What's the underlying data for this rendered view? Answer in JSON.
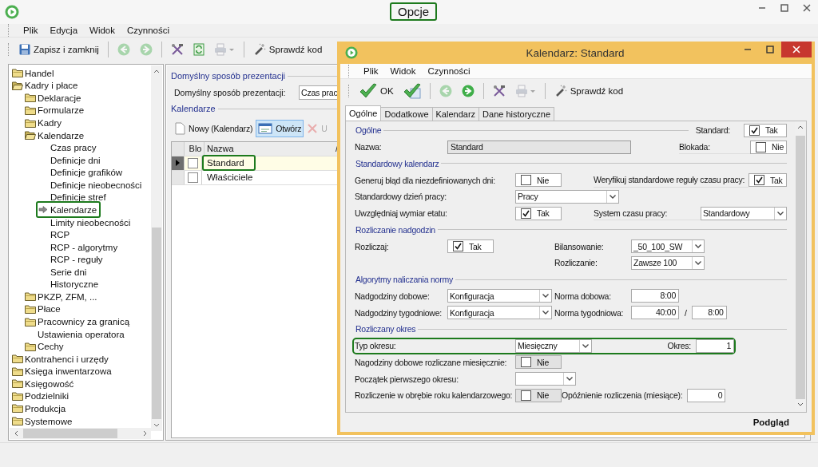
{
  "window": {
    "title": "Opcje",
    "highlighted": true
  },
  "menu": [
    "Plik",
    "Edycja",
    "Widok",
    "Czynności"
  ],
  "toolbar": [
    {
      "kind": "save",
      "label": "Zapisz i zamknij",
      "disabled": false
    },
    {
      "kind": "separator"
    },
    {
      "kind": "back",
      "disabled": true
    },
    {
      "kind": "forward",
      "disabled": true
    },
    {
      "kind": "separator"
    },
    {
      "kind": "tools",
      "disabled": false
    },
    {
      "kind": "refresh",
      "disabled": false
    },
    {
      "kind": "print",
      "disabled": true
    },
    {
      "kind": "separator"
    },
    {
      "kind": "wand",
      "label": "Sprawdź kod",
      "disabled": false
    }
  ],
  "tree": [
    {
      "label": "Handel",
      "kind": "folder",
      "expanded": false,
      "selected": false
    },
    {
      "label": "Kadry i płace",
      "kind": "folder",
      "expanded": true,
      "selected": false,
      "children": [
        {
          "label": "Deklaracje",
          "kind": "folder",
          "expanded": false,
          "selected": false
        },
        {
          "label": "Formularze",
          "kind": "folder",
          "expanded": false,
          "selected": false
        },
        {
          "label": "Kadry",
          "kind": "folder",
          "expanded": false,
          "selected": false
        },
        {
          "label": "Kalendarze",
          "kind": "folder",
          "expanded": true,
          "selected": false,
          "children": [
            {
              "label": "Czas pracy",
              "kind": "leaf",
              "selected": false
            },
            {
              "label": "Definicje dni",
              "kind": "leaf",
              "selected": false
            },
            {
              "label": "Definicje grafików",
              "kind": "leaf",
              "selected": false
            },
            {
              "label": "Definicje nieobecności",
              "kind": "leaf",
              "selected": false
            },
            {
              "label": "Definicje stref",
              "kind": "leaf",
              "selected": false
            },
            {
              "label": "Kalendarze",
              "kind": "leaf",
              "selected": true,
              "highlighted": true
            },
            {
              "label": "Limity nieobecności",
              "kind": "leaf",
              "selected": false
            },
            {
              "label": "RCP",
              "kind": "leaf",
              "selected": false
            },
            {
              "label": "RCP - algorytmy",
              "kind": "leaf",
              "selected": false
            },
            {
              "label": "RCP - reguły",
              "kind": "leaf",
              "selected": false
            },
            {
              "label": "Serie dni",
              "kind": "leaf",
              "selected": false
            },
            {
              "label": "Historyczne",
              "kind": "leaf",
              "selected": false
            }
          ]
        },
        {
          "label": "PKZP, ZFM, ...",
          "kind": "folder",
          "expanded": false,
          "selected": false
        },
        {
          "label": "Płace",
          "kind": "folder",
          "expanded": false,
          "selected": false
        },
        {
          "label": "Pracownicy za granicą",
          "kind": "folder",
          "expanded": false,
          "selected": false
        },
        {
          "label": "Ustawienia operatora",
          "kind": "leaf",
          "selected": false
        },
        {
          "label": "Cechy",
          "kind": "folder",
          "expanded": false,
          "selected": false
        }
      ]
    },
    {
      "label": "Kontrahenci i urzędy",
      "kind": "folder",
      "expanded": false,
      "selected": false
    },
    {
      "label": "Księga inwentarzowa",
      "kind": "folder",
      "expanded": false,
      "selected": false
    },
    {
      "label": "Księgowość",
      "kind": "folder",
      "expanded": false,
      "selected": false
    },
    {
      "label": "Podzielniki",
      "kind": "folder",
      "expanded": false,
      "selected": false
    },
    {
      "label": "Produkcja",
      "kind": "folder",
      "expanded": false,
      "selected": false
    },
    {
      "label": "Systemowe",
      "kind": "folder",
      "expanded": false,
      "selected": false
    }
  ],
  "presentation": {
    "title": "Domyślny sposób prezentacji",
    "label": "Domyślny sposób prezentacji:",
    "value": "Czas prac"
  },
  "calendars": {
    "title": "Kalendarze",
    "buttons": [
      {
        "kind": "new",
        "label": "Nowy (Kalendarz)",
        "selected": false,
        "disabled": false
      },
      {
        "kind": "open",
        "label": "Otwórz",
        "selected": true,
        "disabled": false
      },
      {
        "kind": "delete",
        "label": "U",
        "selected": false,
        "disabled": true
      }
    ],
    "columns": [
      "Blo",
      "Nazwa",
      "/"
    ],
    "rows": [
      {
        "name": "Standard",
        "blocked": false,
        "selected": true,
        "highlighted": true
      },
      {
        "name": "Właściciele",
        "blocked": false,
        "selected": false
      }
    ]
  },
  "dialog": {
    "title": "Kalendarz: Standard",
    "menu": [
      "Plik",
      "Widok",
      "Czynności"
    ],
    "toolbar": [
      {
        "kind": "ok",
        "label": "OK",
        "disabled": false
      },
      {
        "kind": "okdoc",
        "disabled": false
      },
      {
        "kind": "separator"
      },
      {
        "kind": "back",
        "disabled": true
      },
      {
        "kind": "forward",
        "disabled": false
      },
      {
        "kind": "separator"
      },
      {
        "kind": "tools",
        "disabled": false
      },
      {
        "kind": "print",
        "disabled": true
      },
      {
        "kind": "separator"
      },
      {
        "kind": "wand",
        "label": "Sprawdź kod",
        "disabled": false
      }
    ],
    "tabs": [
      {
        "label": "Ogólne",
        "selected": true
      },
      {
        "label": "Dodatkowe",
        "selected": false
      },
      {
        "label": "Kalendarz",
        "selected": false
      },
      {
        "label": "Dane historyczne",
        "selected": false
      }
    ],
    "sections": [
      {
        "title": "Ogólne",
        "header_field": {
          "label": "Standard:",
          "kind": "check",
          "value": "Tak",
          "checked": true
        },
        "rows": [
          {
            "left": {
              "label": "Nazwa:",
              "kind": "text",
              "value": "Standard",
              "disabled": true
            },
            "right": {
              "label": "Blokada:",
              "kind": "check",
              "value": "Nie",
              "checked": false
            }
          }
        ]
      },
      {
        "title": "Standardowy kalendarz",
        "rows": [
          {
            "left": {
              "label": "Generuj błąd dla niezdefiniowanych dni:",
              "kind": "check",
              "value": "Nie",
              "checked": false
            },
            "right": {
              "label": "Weryfikuj standardowe reguły czasu pracy:",
              "kind": "check",
              "value": "Tak",
              "checked": true
            }
          },
          {
            "left": {
              "label": "Standardowy dzień pracy:",
              "kind": "combo",
              "value": "Pracy"
            }
          },
          {
            "left": {
              "label": "Uwzględniaj wymiar etatu:",
              "kind": "check",
              "value": "Tak",
              "checked": true
            },
            "right": {
              "label": "System czasu pracy:",
              "kind": "combo",
              "value": "Standardowy"
            }
          }
        ]
      },
      {
        "title": "Rozliczanie nadgodzin",
        "rows": [
          {
            "left": {
              "label": "Rozliczaj:",
              "kind": "check",
              "value": "Tak",
              "checked": true
            },
            "right": {
              "label": "Bilansowanie:",
              "kind": "combo",
              "value": "_50_100_SW"
            }
          },
          {
            "right": {
              "label": "Rozliczanie:",
              "kind": "combo",
              "value": "Zawsze 100"
            }
          }
        ]
      },
      {
        "title": "Algorytmy naliczania normy",
        "rows": [
          {
            "left": {
              "label": "Nadgodziny dobowe:",
              "kind": "combo",
              "value": "Konfiguracja"
            },
            "right": {
              "label": "Norma dobowa:",
              "kind": "number",
              "value": "8:00"
            }
          },
          {
            "left": {
              "label": "Nadgodziny tygodniowe:",
              "kind": "combo",
              "value": "Konfiguracja"
            },
            "right": {
              "label": "Norma tygodniowa:",
              "kind": "number",
              "value": "40:00",
              "divider": "/",
              "second_value": "8:00"
            }
          }
        ]
      },
      {
        "title": "Rozliczany okres",
        "rows": [
          {
            "highlighted": true,
            "left": {
              "label": "Typ okresu:",
              "kind": "combo",
              "value": "Miesięczny"
            },
            "right": {
              "label": "Okres:",
              "kind": "number",
              "value": "1"
            }
          },
          {
            "left": {
              "label": "Nagodziny dobowe rozliczane miesięcznie:",
              "kind": "check",
              "value": "Nie",
              "checked": false,
              "disabled": true
            }
          },
          {
            "left": {
              "label": "Początek pierwszego okresu:",
              "kind": "combo"
            }
          },
          {
            "left": {
              "label": "Rozliczenie w obrębie roku kalendarzowego:",
              "kind": "check",
              "value": "Nie",
              "checked": false,
              "disabled": true
            },
            "right": {
              "label": "Opóźnienie rozliczenia (miesiące):",
              "kind": "number",
              "value": "0"
            }
          }
        ]
      }
    ],
    "footer": "Podgląd"
  }
}
